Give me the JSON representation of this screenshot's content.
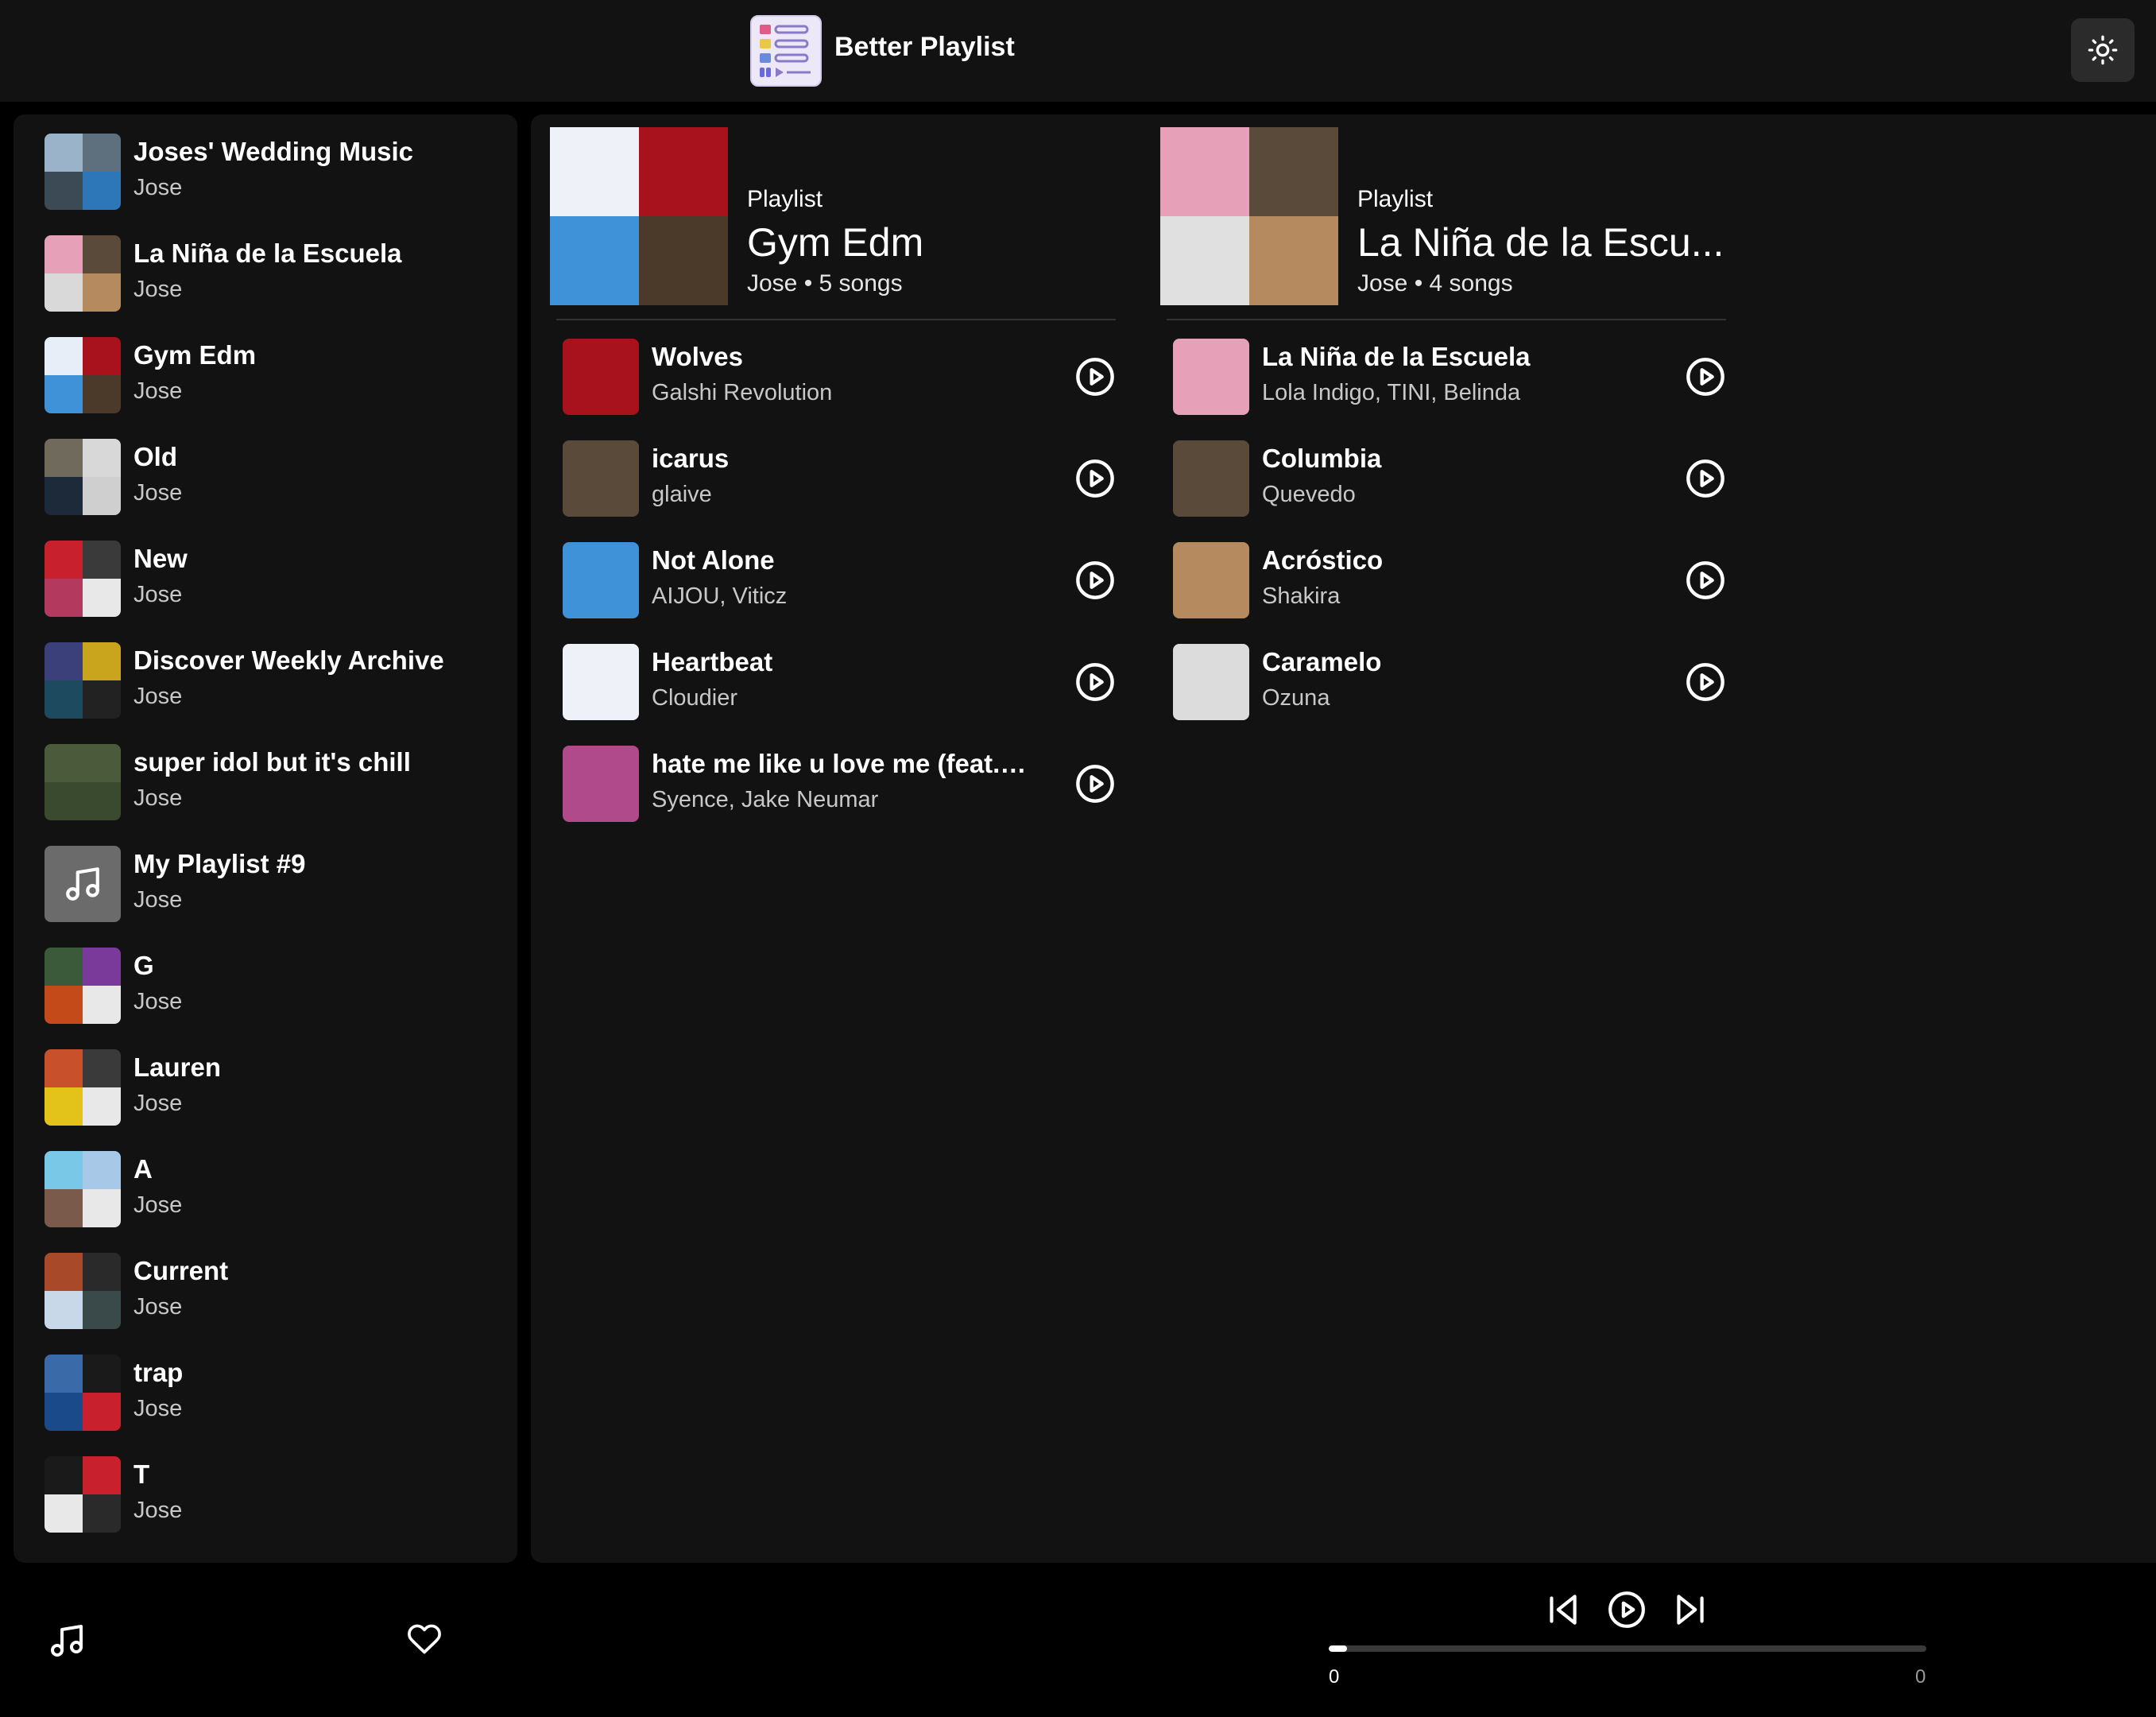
{
  "app": {
    "title": "Better Playlist"
  },
  "sidebar": {
    "items": [
      {
        "name": "Joses' Wedding Music",
        "owner": "Jose",
        "cover": [
          "#9bb3c9",
          "#5e6f7d",
          "#3b4a55",
          "#2d77b8"
        ]
      },
      {
        "name": "La Niña de la Escuela",
        "owner": "Jose",
        "cover": [
          "#e6a0b8",
          "#5a4a3a",
          "#d9d9d9",
          "#b58a5e"
        ]
      },
      {
        "name": "Gym Edm",
        "owner": "Jose",
        "cover": [
          "#e7eef8",
          "#a8121c",
          "#3f92d8",
          "#4b3a2a"
        ]
      },
      {
        "name": "Old",
        "owner": "Jose",
        "cover": [
          "#6f6a5c",
          "#d8d8d8",
          "#1d2a3a",
          "#cfcfcf"
        ]
      },
      {
        "name": "New",
        "owner": "Jose",
        "cover": [
          "#c8202c",
          "#3a3a3a",
          "#b33a5e",
          "#e8e8e8"
        ]
      },
      {
        "name": "Discover Weekly Archive",
        "owner": "Jose",
        "cover": [
          "#3b3f7a",
          "#c9a51e",
          "#1d4a5e",
          "#222222"
        ]
      },
      {
        "name": "super idol but it's chill",
        "owner": "Jose",
        "cover": [
          "#4a5a3a",
          "#4a5a3a",
          "#3a4a2e",
          "#3a4a2e"
        ]
      },
      {
        "name": "My Playlist #9",
        "owner": "Jose",
        "cover": []
      },
      {
        "name": "G",
        "owner": "Jose",
        "cover": [
          "#3a5a3a",
          "#7a3a9a",
          "#c44a1a",
          "#e8e8e8"
        ]
      },
      {
        "name": "Lauren",
        "owner": "Jose",
        "cover": [
          "#c8502a",
          "#3a3a3a",
          "#e3c21a",
          "#e8e8e8"
        ]
      },
      {
        "name": "A",
        "owner": "Jose",
        "cover": [
          "#7ac8e8",
          "#a8c8e8",
          "#7a5a4a",
          "#e8e8e8"
        ]
      },
      {
        "name": "Current",
        "owner": "Jose",
        "cover": [
          "#a84a2a",
          "#2a2a2a",
          "#c8d8e8",
          "#3a4a4a"
        ]
      },
      {
        "name": "trap",
        "owner": "Jose",
        "cover": [
          "#3a6aa8",
          "#1a1a1a",
          "#1a4a8a",
          "#c8202c"
        ]
      },
      {
        "name": "T",
        "owner": "Jose",
        "cover": [
          "#1a1a1a",
          "#c8202c",
          "#e8e8e8",
          "#2a2a2a"
        ]
      }
    ]
  },
  "columns": [
    {
      "type_label": "Playlist",
      "title": "Gym Edm",
      "meta": "Jose • 5 songs",
      "cover": [
        "#eef2f8",
        "#a8121c",
        "#3f92d8",
        "#4b3a2a"
      ],
      "songs": [
        {
          "title": "Wolves",
          "artist": "Galshi Revolution",
          "color": "#a8121c"
        },
        {
          "title": "icarus",
          "artist": "glaive",
          "color": "#5a4a3a"
        },
        {
          "title": "Not Alone",
          "artist": "AIJOU, Viticz",
          "color": "#3f92d8"
        },
        {
          "title": "Heartbeat",
          "artist": "Cloudier",
          "color": "#eef2f8"
        },
        {
          "title": "hate me like u love me (feat. j...",
          "artist": "Syence, Jake Neumar",
          "color": "#b04a8a"
        }
      ]
    },
    {
      "type_label": "Playlist",
      "title": "La Niña de la Escu...",
      "meta": "Jose • 4 songs",
      "cover": [
        "#e6a0b8",
        "#5a4a3a",
        "#e0e0e0",
        "#b58a5e"
      ],
      "songs": [
        {
          "title": "La Niña de la Escuela",
          "artist": "Lola Indigo, TINI, Belinda",
          "color": "#e6a0b8"
        },
        {
          "title": "Columbia",
          "artist": "Quevedo",
          "color": "#5a4a3a"
        },
        {
          "title": "Acróstico",
          "artist": "Shakira",
          "color": "#b58a5e"
        },
        {
          "title": "Caramelo",
          "artist": "Ozuna",
          "color": "#dcdcdc"
        }
      ]
    }
  ],
  "player": {
    "time_current": "0",
    "time_total": "0",
    "progress": 0.03
  },
  "colors": {
    "background": "#000000",
    "panel": "#121212",
    "text_secondary": "#c8c8c8"
  }
}
